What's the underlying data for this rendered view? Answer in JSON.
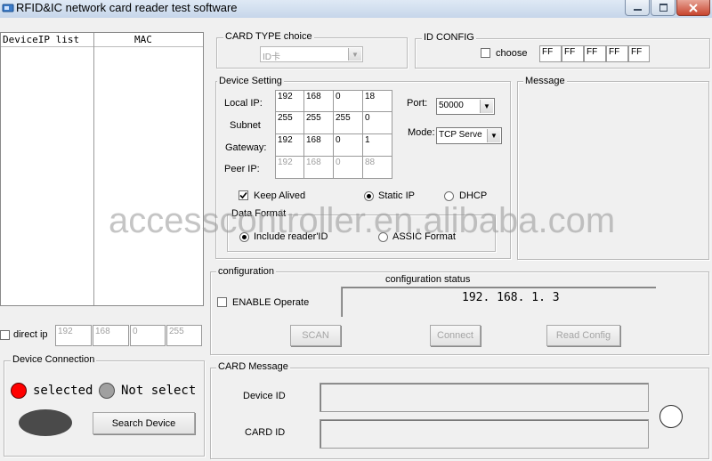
{
  "window": {
    "title": "RFID&IC network card reader test software"
  },
  "device_list": {
    "col_ip": "DeviceIP list",
    "col_mac": "MAC"
  },
  "direct_ip": {
    "label": "direct ip",
    "octets": [
      "192",
      "168",
      "0",
      "255"
    ]
  },
  "device_connection": {
    "legend": "Device Connection",
    "selected_label": "selected",
    "not_select_label": "Not select",
    "search_button": "Search Device",
    "colors": {
      "selected": "#ff0000",
      "not_select": "#a0a0a0",
      "status_oval": "#4a4a4a"
    }
  },
  "card_type": {
    "legend": "CARD TYPE choice",
    "value": "ID卡"
  },
  "id_config": {
    "legend": "ID CONFIG",
    "choose_label": "choose",
    "bytes": [
      "FF",
      "FF",
      "FF",
      "FF",
      "FF"
    ]
  },
  "device_setting": {
    "legend": "Device Setting",
    "local_ip_label": "Local IP:",
    "subnet_label": "Subnet",
    "gateway_label": "Gateway:",
    "peer_ip_label": "Peer IP:",
    "local_ip": [
      "192",
      "168",
      "0",
      "18"
    ],
    "subnet": [
      "255",
      "255",
      "255",
      "0"
    ],
    "gateway": [
      "192",
      "168",
      "0",
      "1"
    ],
    "peer_ip": [
      "192",
      "168",
      "0",
      "88"
    ],
    "port_label": "Port:",
    "port_value": "50000",
    "mode_label": "Mode:",
    "mode_value": "TCP Serve",
    "keep_alive_label": "Keep Alived",
    "static_ip_label": "Static IP",
    "dhcp_label": "DHCP",
    "data_format_legend": "Data Format",
    "include_reader_id_label": "Include reader'ID",
    "assic_format_label": "ASSIC Format"
  },
  "message": {
    "legend": "Message"
  },
  "watermark": "accesscontroller.en.alibaba.com",
  "configuration": {
    "legend": "configuration",
    "status_label": "configuration status",
    "status_value": "192. 168. 1. 3",
    "enable_label": "ENABLE Operate",
    "scan_button": "SCAN",
    "connect_button": "Connect",
    "read_config_button": "Read Config"
  },
  "card_message": {
    "legend": "CARD Message",
    "device_id_label": "Device ID",
    "card_id_label": "CARD ID"
  }
}
